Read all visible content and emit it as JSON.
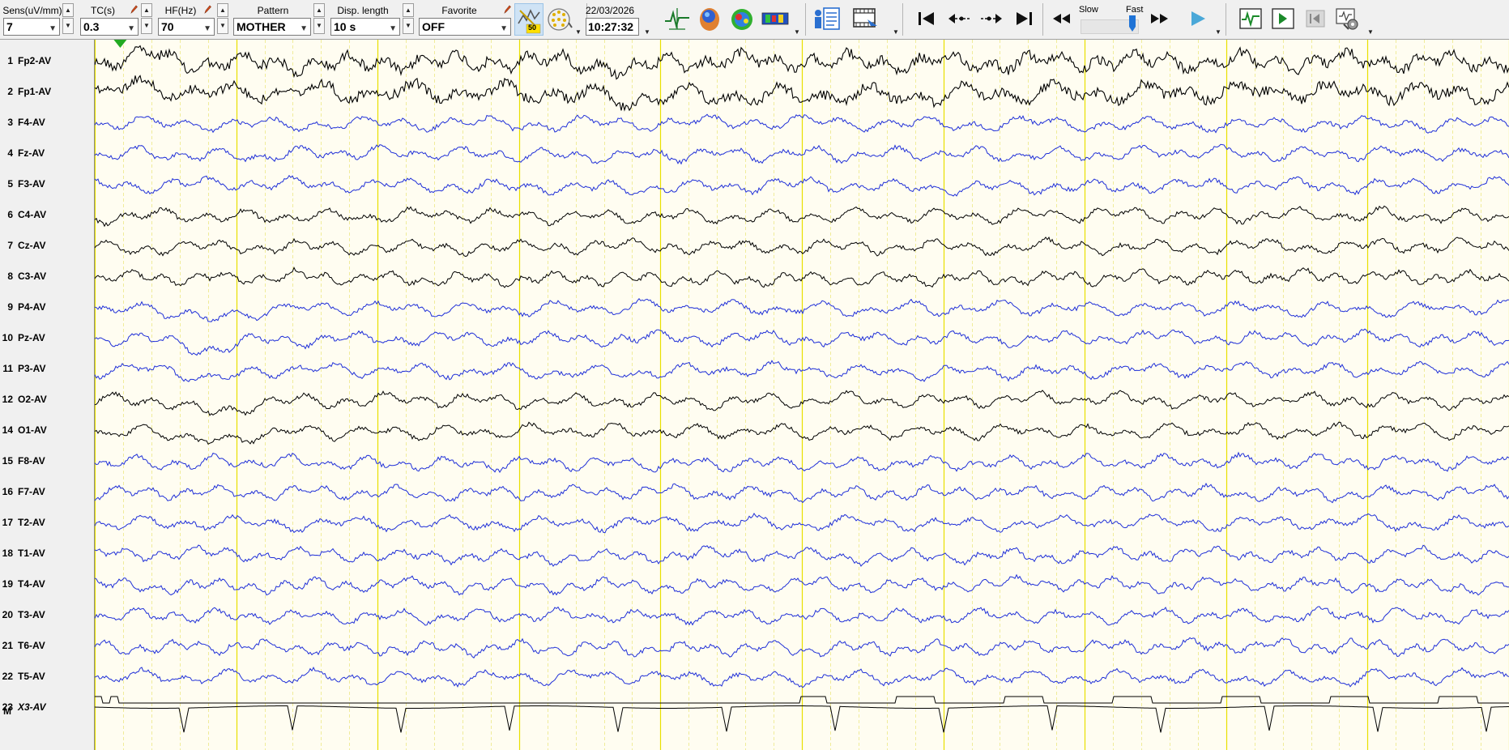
{
  "toolbar": {
    "sens": {
      "label": "Sens(uV/mm)",
      "value": "7"
    },
    "tc": {
      "label": "TC(s)",
      "value": "0.3"
    },
    "hf": {
      "label": "HF(Hz)",
      "value": "70"
    },
    "pattern": {
      "label": "Pattern",
      "value": "MOTHER"
    },
    "disp_length": {
      "label": "Disp. length",
      "value": "10 s"
    },
    "favorite": {
      "label": "Favorite",
      "value": "OFF"
    },
    "notch_badge": "50",
    "date": "22/03/2026",
    "time": "10:27:32",
    "speed": {
      "slow_label": "Slow",
      "fast_label": "Fast",
      "level": 0.95
    },
    "icons": [
      "notch-filter-icon",
      "electrode-map-icon",
      "signal-marker-icon",
      "head-map-icon",
      "topo-map-icon",
      "spectrum-icon",
      "patient-info-icon",
      "video-icon",
      "go-start-icon",
      "prev-event-icon",
      "next-event-icon",
      "go-end-icon",
      "rewind-icon",
      "fast-forward-icon",
      "play-icon",
      "montage-icon",
      "next-page-icon",
      "prev-page-icon",
      "settings-icon"
    ]
  },
  "channels": [
    {
      "num": "1",
      "name": "Fp2-AV",
      "color": "#000000"
    },
    {
      "num": "2",
      "name": "Fp1-AV",
      "color": "#000000"
    },
    {
      "num": "3",
      "name": "F4-AV",
      "color": "#1f2fd8"
    },
    {
      "num": "4",
      "name": "Fz-AV",
      "color": "#1f2fd8"
    },
    {
      "num": "5",
      "name": "F3-AV",
      "color": "#1f2fd8"
    },
    {
      "num": "6",
      "name": "C4-AV",
      "color": "#000000"
    },
    {
      "num": "7",
      "name": "Cz-AV",
      "color": "#000000"
    },
    {
      "num": "8",
      "name": "C3-AV",
      "color": "#000000"
    },
    {
      "num": "9",
      "name": "P4-AV",
      "color": "#1f2fd8"
    },
    {
      "num": "10",
      "name": "Pz-AV",
      "color": "#1f2fd8"
    },
    {
      "num": "11",
      "name": "P3-AV",
      "color": "#1f2fd8"
    },
    {
      "num": "12",
      "name": "O2-AV",
      "color": "#000000"
    },
    {
      "num": "14",
      "name": "O1-AV",
      "color": "#000000"
    },
    {
      "num": "15",
      "name": "F8-AV",
      "color": "#1f2fd8"
    },
    {
      "num": "16",
      "name": "F7-AV",
      "color": "#1f2fd8"
    },
    {
      "num": "17",
      "name": "T2-AV",
      "color": "#1f2fd8"
    },
    {
      "num": "18",
      "name": "T1-AV",
      "color": "#1f2fd8"
    },
    {
      "num": "19",
      "name": "T4-AV",
      "color": "#1f2fd8"
    },
    {
      "num": "20",
      "name": "T3-AV",
      "color": "#1f2fd8"
    },
    {
      "num": "21",
      "name": "T6-AV",
      "color": "#1f2fd8"
    },
    {
      "num": "22",
      "name": "T5-AV",
      "color": "#1f2fd8"
    },
    {
      "num": "23",
      "name": "X3-AV",
      "color": "#000000",
      "italic": true
    },
    {
      "num": "",
      "name": "M",
      "color": "#000000"
    }
  ],
  "colors": {
    "background": "#fffdf1",
    "grid_major": "#e8e000",
    "grid_minor": "#f0ec9a",
    "trace_black": "#000000",
    "trace_blue": "#1f2fd8",
    "marker": "#22aa22"
  },
  "recording": {
    "duration_s": 10,
    "event_marker_s": 0.18
  }
}
